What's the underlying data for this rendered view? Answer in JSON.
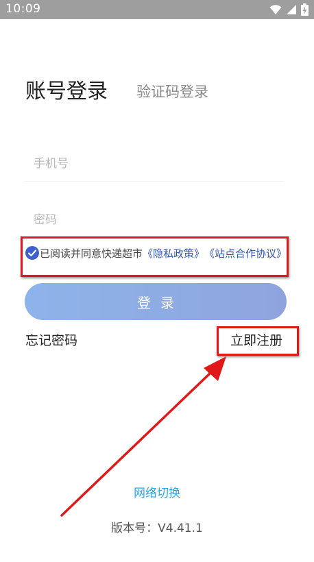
{
  "status_bar": {
    "time": "10:09"
  },
  "tabs": {
    "account_login": "账号登录",
    "sms_login": "验证码登录"
  },
  "form": {
    "phone_placeholder": "手机号",
    "password_placeholder": "密码"
  },
  "agreement": {
    "prefix": "已阅读并同意快递超市",
    "privacy_link": "《隐私政策》",
    "partner_link": "《站点合作协议》",
    "checked": true
  },
  "login_button": "登录",
  "forgot_password": "忘记密码",
  "register_now": "立即注册",
  "network_switch": "网络切换",
  "version": "版本号：V4.41.1",
  "colors": {
    "accent": "#3d5fcf",
    "link": "#2f55b5",
    "network_link": "#2aa6e8",
    "button_gradient_start": "#8db4ea",
    "button_gradient_end": "#8fa4de",
    "annotation_red": "#e01818"
  }
}
